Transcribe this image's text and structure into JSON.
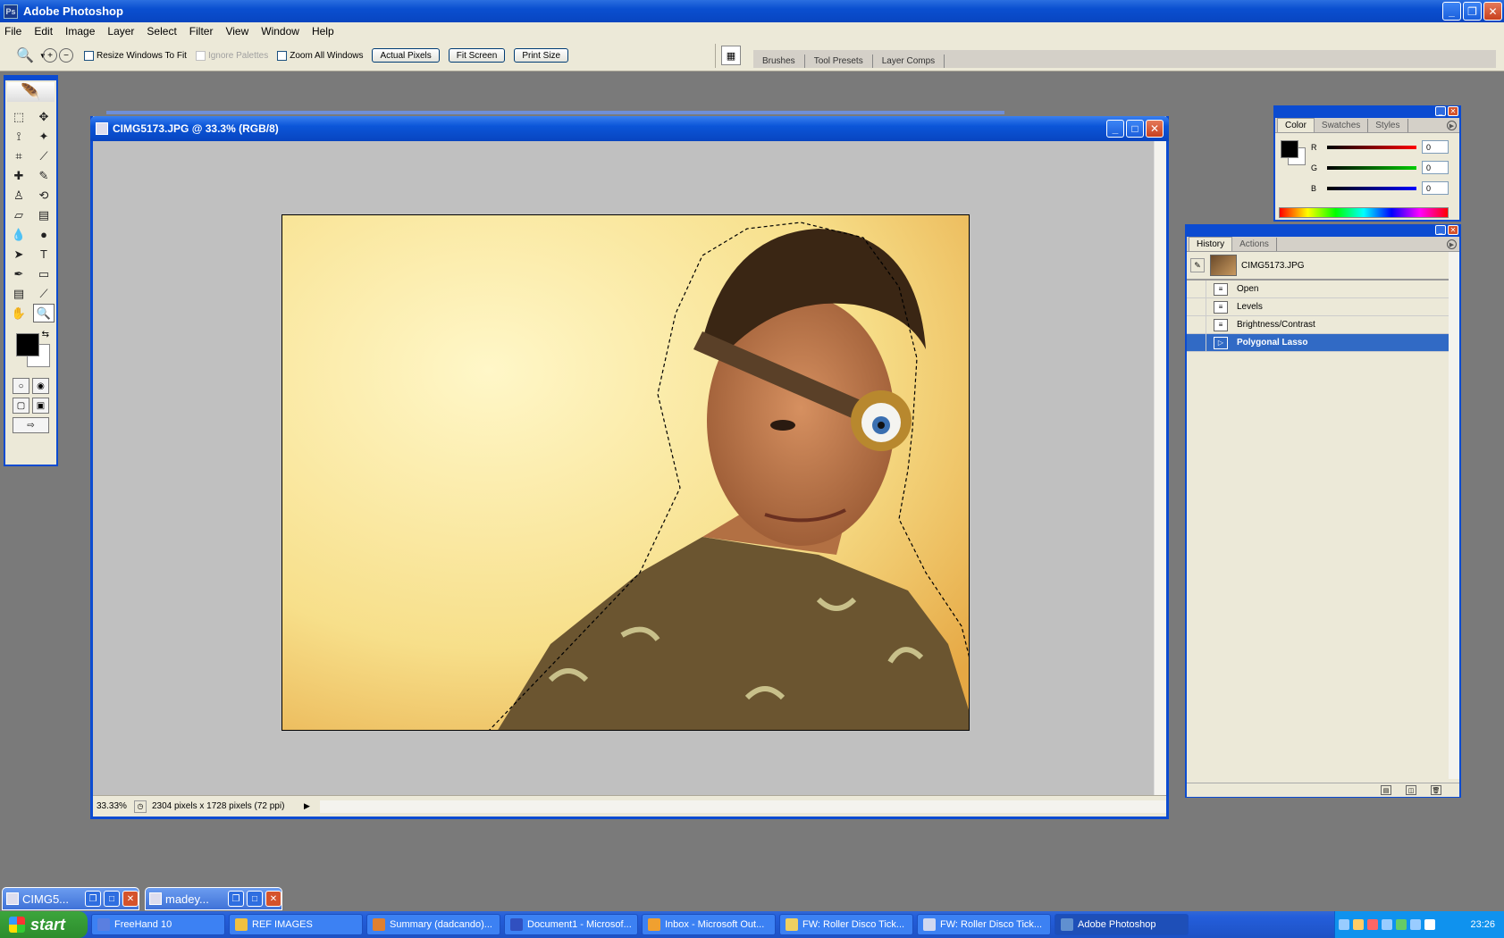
{
  "app": {
    "title": "Adobe Photoshop",
    "logo": "Ps"
  },
  "menu": [
    "File",
    "Edit",
    "Image",
    "Layer",
    "Select",
    "Filter",
    "View",
    "Window",
    "Help"
  ],
  "options": {
    "resize_windows": "Resize Windows To Fit",
    "ignore_palettes": "Ignore Palettes",
    "zoom_all": "Zoom All Windows",
    "actual_pixels": "Actual Pixels",
    "fit_screen": "Fit Screen",
    "print_size": "Print Size",
    "well_tabs": [
      "Brushes",
      "Tool Presets",
      "Layer Comps"
    ]
  },
  "document": {
    "title": "CIMG5173.JPG @ 33.3% (RGB/8)",
    "zoom": "33.33%",
    "dimensions": "2304 pixels x 1728 pixels (72 ppi)"
  },
  "color_panel": {
    "tabs": [
      "Color",
      "Swatches",
      "Styles"
    ],
    "r_label": "R",
    "g_label": "G",
    "b_label": "B",
    "r_value": "0",
    "g_value": "0",
    "b_value": "0"
  },
  "history_panel": {
    "tabs": [
      "History",
      "Actions"
    ],
    "snapshot": "CIMG5173.JPG",
    "items": [
      "Open",
      "Levels",
      "Brightness/Contrast",
      "Polygonal Lasso"
    ],
    "selected_index": 3
  },
  "minimized": [
    {
      "label": "CIMG5..."
    },
    {
      "label": "madey..."
    }
  ],
  "taskbar": {
    "start": "start",
    "items": [
      {
        "label": "FreeHand 10",
        "color": "#5a7fe0"
      },
      {
        "label": "REF IMAGES",
        "color": "#f0c040"
      },
      {
        "label": "Summary (dadcando)...",
        "color": "#e08030"
      },
      {
        "label": "Document1 - Microsof...",
        "color": "#3050c0"
      },
      {
        "label": "Inbox - Microsoft Out...",
        "color": "#f0a030"
      },
      {
        "label": "FW: Roller Disco Tick...",
        "color": "#f0d060"
      },
      {
        "label": "FW: Roller Disco Tick...",
        "color": "#d0d8f0"
      },
      {
        "label": "Adobe Photoshop",
        "color": "#6090d0"
      }
    ],
    "clock": "23:26"
  }
}
